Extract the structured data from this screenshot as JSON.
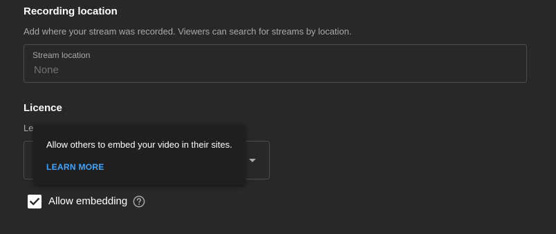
{
  "recording_location": {
    "title": "Recording location",
    "description": "Add where your stream was recorded. Viewers can search for streams by location.",
    "field_label": "Stream location",
    "field_value": "None"
  },
  "licence": {
    "title": "Licence",
    "description_partial": "Le"
  },
  "tooltip": {
    "text": "Allow others to embed your video in their sites.",
    "link_label": "LEARN MORE"
  },
  "embedding": {
    "label": "Allow embedding",
    "checked": true
  },
  "colors": {
    "background": "#282828",
    "link": "#3ea6ff",
    "tooltip_bg": "#1f1f1f"
  },
  "icons": [
    "check-icon",
    "help-circle-icon",
    "dropdown-arrow-icon"
  ]
}
